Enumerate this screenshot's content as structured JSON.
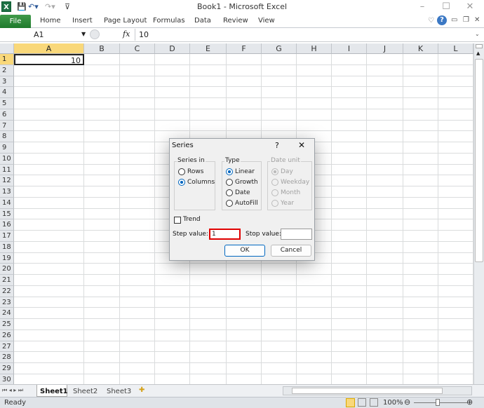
{
  "window": {
    "title": "Book1  -  Microsoft Excel",
    "app_icon": "X"
  },
  "ribbon": {
    "file": "File",
    "tabs": [
      "Home",
      "Insert",
      "Page Layout",
      "Formulas",
      "Data",
      "Review",
      "View"
    ]
  },
  "formula_bar": {
    "name_box": "A1",
    "fx": "fx",
    "value": "10"
  },
  "sheet": {
    "columns": [
      "A",
      "B",
      "C",
      "D",
      "E",
      "F",
      "G",
      "H",
      "I",
      "J",
      "K",
      "L"
    ],
    "row_count": 31,
    "selected_cell": "A1",
    "cells": {
      "A1": "10"
    }
  },
  "sheet_tabs": [
    "Sheet1",
    "Sheet2",
    "Sheet3"
  ],
  "active_sheet": "Sheet1",
  "status": {
    "text": "Ready",
    "zoom": "100%"
  },
  "dialog": {
    "title": "Series",
    "help": "?",
    "close": "✕",
    "series_in": {
      "label": "Series in",
      "options": [
        "Rows",
        "Columns"
      ],
      "selected": "Columns"
    },
    "type": {
      "label": "Type",
      "options": [
        "Linear",
        "Growth",
        "Date",
        "AutoFill"
      ],
      "selected": "Linear"
    },
    "date_unit": {
      "label": "Date unit",
      "options": [
        "Day",
        "Weekday",
        "Month",
        "Year"
      ],
      "selected": "Day",
      "disabled": true
    },
    "trend": {
      "label": "Trend",
      "checked": false
    },
    "step_label": "Step value:",
    "step_value": "1",
    "stop_label": "Stop value:",
    "stop_value": "",
    "ok": "OK",
    "cancel": "Cancel"
  },
  "colors": {
    "file_tab": "#2a8a36",
    "selection": "#f9d87a",
    "highlight_border": "#e00000",
    "accent": "#0067c0"
  }
}
